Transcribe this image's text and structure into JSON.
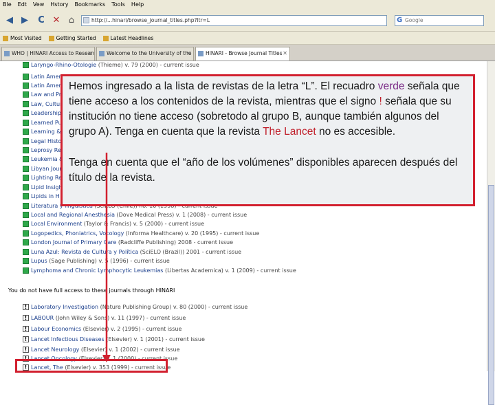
{
  "menu": [
    "Ble",
    "Edt",
    "Vew",
    "Hstory",
    "Bookmarks",
    "Tools",
    "Help"
  ],
  "nav": {
    "back": "◀",
    "forward": "▶",
    "reload": "C",
    "stop": "✕",
    "home": "⌂",
    "address": "http://...hinari/browse_journal_titles.php?ltr=L",
    "search_placeholder": "Google"
  },
  "bookmarks": [
    "Most Visited",
    "Getting Started",
    "Latest Headlines"
  ],
  "tabs": [
    {
      "label": "WHO | HINARI Access to Research in..."
    },
    {
      "label": "Welcome to the University of the West..."
    },
    {
      "label": "HINARI - Browse Journal Titles"
    }
  ],
  "journals_green": [
    {
      "title": "Laryngo-Rhino-Otologie",
      "detail": " (Thieme) v. 79 (2000) - current issue"
    },
    {
      "title": "Latin Amer",
      "detail": ""
    },
    {
      "title": "Latin Amer",
      "detail": ""
    },
    {
      "title": "Law and Pr",
      "detail": ""
    },
    {
      "title": "Law, Cultur",
      "detail": ""
    },
    {
      "title": "Leadership",
      "detail": ""
    },
    {
      "title": "Learned Pu",
      "detail": ""
    },
    {
      "title": "Learning &",
      "detail": ""
    },
    {
      "title": "Legal Histo",
      "detail": ""
    },
    {
      "title": "Leprosy Re",
      "detail": ""
    },
    {
      "title": "Leukemia &",
      "detail": ""
    },
    {
      "title": "Libyan Jour",
      "detail": ""
    },
    {
      "title": "Lighting Re",
      "detail": ""
    },
    {
      "title": "Lipid Insigh",
      "detail": ""
    },
    {
      "title": "Lipids in H",
      "detail": ""
    },
    {
      "title": "Literatura y lingüística",
      "detail": " (SciELO (Chile)) no. 10 (1998) - current issue"
    },
    {
      "title": "Local and Regional Anesthesia",
      "detail": " (Dove Medical Press) v. 1 (2008) - current issue"
    },
    {
      "title": "Local Environment",
      "detail": " (Taylor & Francis) v. 5 (2000) - current issue"
    },
    {
      "title": "Logopedics, Phoniatrics, Vocology",
      "detail": " (Informa Healthcare) v. 20 (1995) - current issue"
    },
    {
      "title": "London Journal of Primary Care",
      "detail": " (Radcliffe Publishing) 2008 - current issue"
    },
    {
      "title": "Luna Azul: Revista de Cultura y Política",
      "detail": " (SciELO (Brazil)) 2001 - current issue"
    },
    {
      "title": "Lupus",
      "detail": " (Sage Publishing) v. 5 (1996) - current issue"
    },
    {
      "title": "Lymphoma and Chronic Lymphocytic Leukemias",
      "detail": " (Libertas Academica) v. 1 (2009) - current issue"
    }
  ],
  "no_access_text": "You do not have full access to these journals through HINARI",
  "journals_restricted": [
    {
      "title": "Laboratory Investigation",
      "detail": " (Nature Publishing Group) v. 80 (2000) - current issue"
    },
    {
      "title": "LABOUR",
      "detail": " (John Wiley & Sons) v. 11 (1997) - current issue"
    },
    {
      "title": "Labour Economics",
      "detail": " (Elsevier) v. 2 (1995) - current issue"
    },
    {
      "title": "Lancet Infectious Diseases",
      "detail": " (Elsevier) v. 1 (2001) - current issue"
    },
    {
      "title": "Lancet Neurology",
      "detail": " (Elsevier) v. 1 (2002) - current issue"
    },
    {
      "title": "Lancet Oncology",
      "detail": " (Elsevier) v. 1 (2000) - current issue"
    },
    {
      "title": "Lancet, The",
      "detail": " (Elsevier) v. 353 (1999) - current issue"
    }
  ],
  "callout": {
    "p1_a": "Hemos ingresado a la lista de revistas de la letra “L”. El recuadro ",
    "p1_green": "verde",
    "p1_b": " señala que tiene acceso a los contenidos de la revista, mientras que el signo ",
    "p1_excl": "!",
    "p1_c": " señala que su institución no tiene acceso (sobretodo al grupo B, aunque también algunos del grupo A). Tenga en cuenta que la revista ",
    "p1_lancet": "The Lancet",
    "p1_d": "  no es accesible.",
    "p2": "Tenga en cuenta que el “año de los volúmenes” disponibles aparecen después del título de la revista."
  },
  "colors": {
    "callout_border": "#d2202f",
    "green_icon": "#2fa84a",
    "purple_word": "#7a2b86",
    "red_accent": "#c01e29"
  }
}
